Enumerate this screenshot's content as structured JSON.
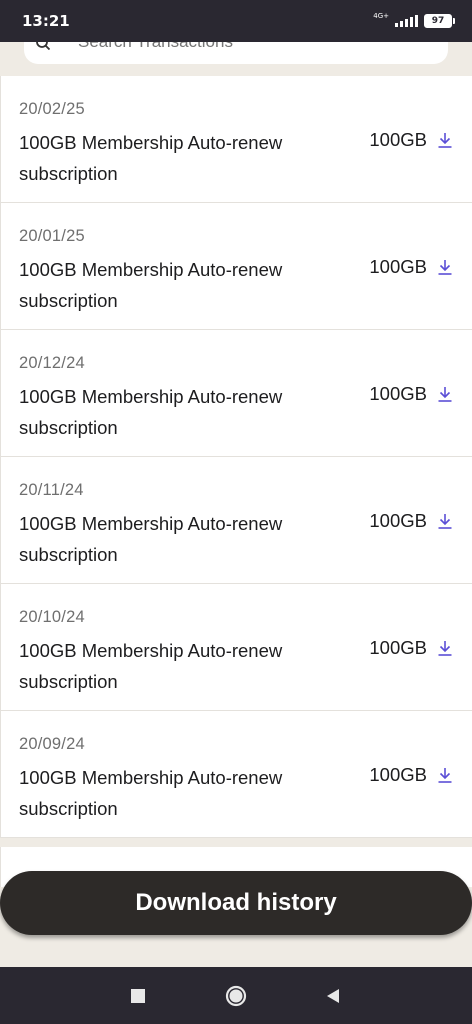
{
  "status": {
    "time": "13:21",
    "network": "4G+",
    "battery": "97"
  },
  "search": {
    "placeholder": "Search Transactions"
  },
  "transactions": [
    {
      "date": "20/02/25",
      "description": "100GB Membership Auto-renew subscription",
      "amount": "100GB"
    },
    {
      "date": "20/01/25",
      "description": "100GB Membership Auto-renew subscription",
      "amount": "100GB"
    },
    {
      "date": "20/12/24",
      "description": "100GB Membership Auto-renew subscription",
      "amount": "100GB"
    },
    {
      "date": "20/11/24",
      "description": "100GB Membership Auto-renew subscription",
      "amount": "100GB"
    },
    {
      "date": "20/10/24",
      "description": "100GB Membership Auto-renew subscription",
      "amount": "100GB"
    },
    {
      "date": "20/09/24",
      "description": "100GB Membership Auto-renew subscription",
      "amount": "100GB"
    }
  ],
  "footer": {
    "download_label": "Download history"
  },
  "colors": {
    "accent": "#5b4fd6",
    "button_bg": "#2d2a28",
    "background": "#efebe4",
    "system_bar": "#2a2831"
  },
  "icons": {
    "search": "search-icon",
    "download": "download-icon",
    "recents": "square-icon",
    "home": "circle-icon",
    "back": "triangle-back-icon"
  }
}
